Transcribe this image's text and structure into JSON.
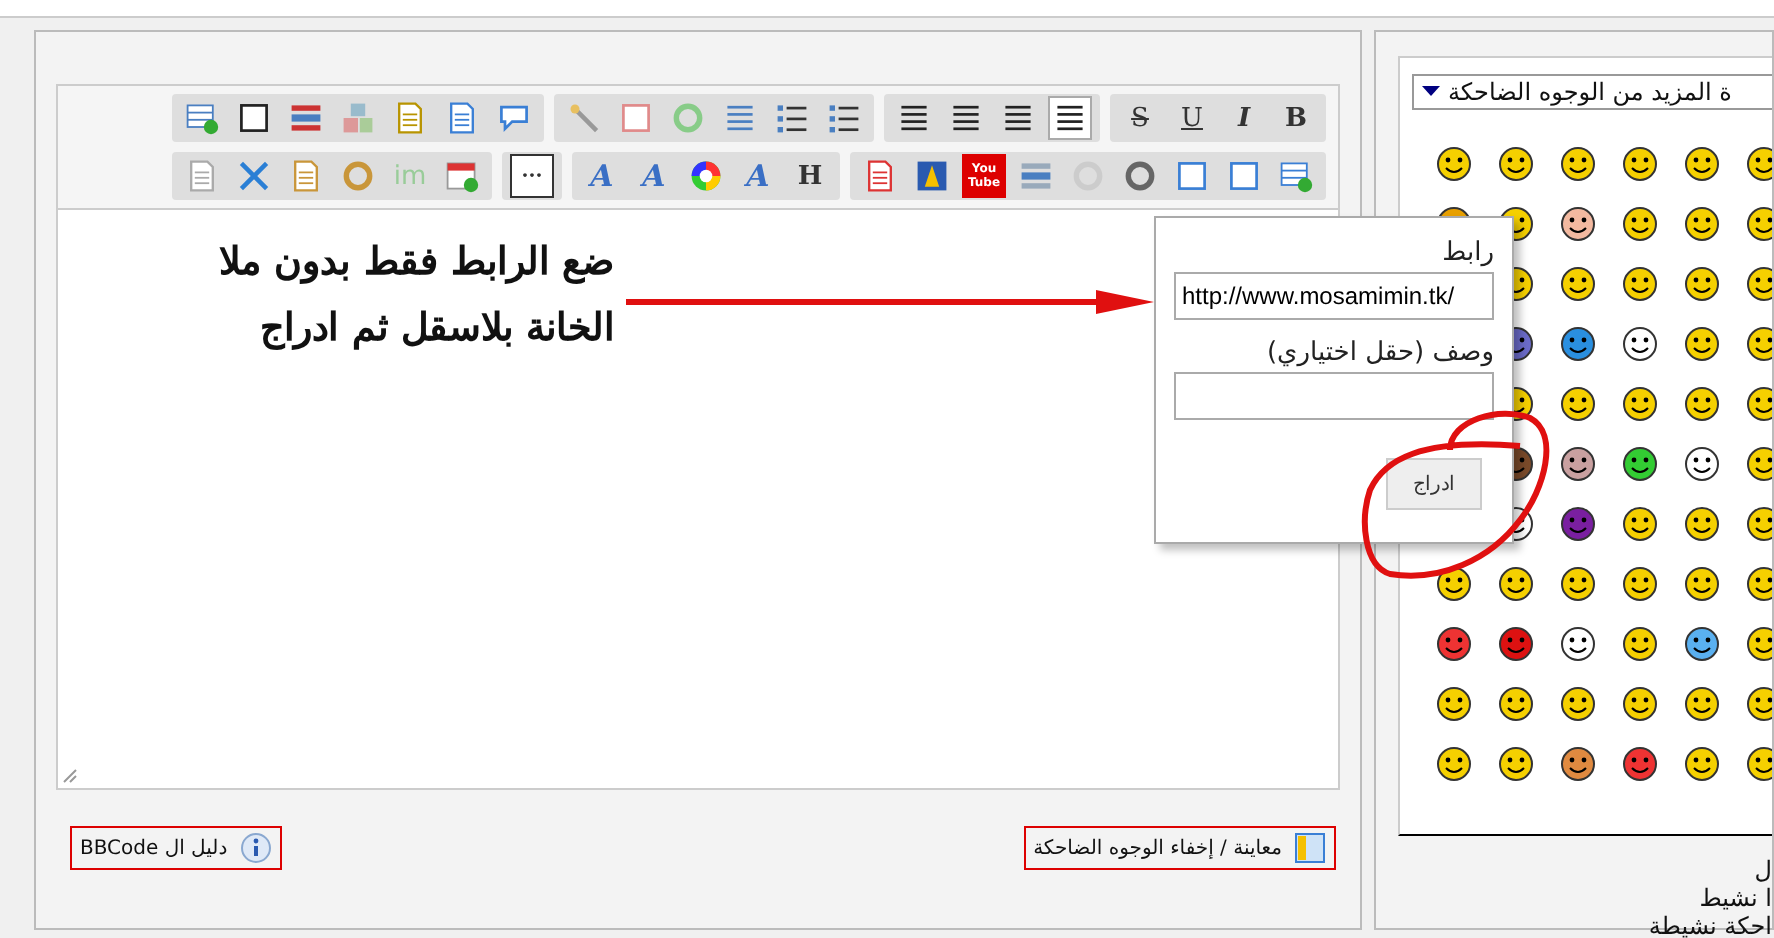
{
  "toolbar": {
    "rows": [
      {
        "groups": [
          [
            {
              "kind": "text",
              "label": "B"
            },
            {
              "kind": "text",
              "label": "I"
            },
            {
              "kind": "text",
              "label": "U"
            },
            {
              "kind": "text",
              "label": "S"
            }
          ],
          [
            {
              "kind": "icon",
              "selected": true
            },
            {
              "kind": "icon",
              "selected": false
            },
            {
              "kind": "icon",
              "selected": false
            },
            {
              "kind": "icon",
              "selected": false
            }
          ],
          [
            {
              "kind": "icon"
            },
            {
              "kind": "icon"
            },
            {
              "kind": "icon"
            },
            {
              "kind": "icon"
            },
            {
              "kind": "icon"
            },
            {
              "kind": "icon"
            }
          ],
          [
            {
              "kind": "icon"
            },
            {
              "kind": "icon"
            },
            {
              "kind": "icon"
            },
            {
              "kind": "icon"
            },
            {
              "kind": "icon"
            },
            {
              "kind": "icon"
            },
            {
              "kind": "icon"
            }
          ]
        ]
      },
      {
        "groups": [
          [
            {
              "kind": "icon"
            },
            {
              "kind": "icon"
            },
            {
              "kind": "icon"
            },
            {
              "kind": "icon"
            },
            {
              "kind": "icon"
            },
            {
              "kind": "icon"
            },
            {
              "kind": "text",
              "label": "You Tube"
            },
            {
              "kind": "icon"
            },
            {
              "kind": "icon"
            }
          ],
          [
            {
              "kind": "text",
              "label": "H"
            },
            {
              "kind": "text",
              "label": "A"
            },
            {
              "kind": "icon"
            },
            {
              "kind": "text",
              "label": "A"
            },
            {
              "kind": "text",
              "label": "A"
            }
          ],
          [
            {
              "kind": "text",
              "label": "···"
            }
          ],
          [
            {
              "kind": "icon"
            },
            {
              "kind": "text",
              "label": "im"
            },
            {
              "kind": "icon"
            },
            {
              "kind": "icon"
            },
            {
              "kind": "icon"
            },
            {
              "kind": "icon"
            }
          ]
        ]
      }
    ]
  },
  "editor": {
    "note_lines": [
      "ضع الرابط فقط بدون ملا",
      "الخانة بلاسقل ثم ادراج"
    ]
  },
  "link_popup": {
    "url_label": "رابط",
    "url_value": "http://www.mosamimin.tk/",
    "description_label": "وصف (حقل اختياري)",
    "insert_button": "ادراج"
  },
  "footer": {
    "bbcode_button": "دليل ال BBCode",
    "preview_button": "معاينة / إخفاء الوجوه الضاحكة"
  },
  "smilies": {
    "dropdown": "ة المزيد من الوجوه الضاحكة",
    "notes": [
      "ل",
      "ا نشيط",
      "احكة نشيطة"
    ]
  }
}
